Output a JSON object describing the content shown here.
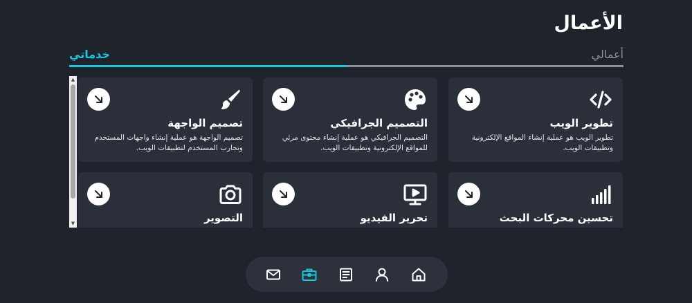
{
  "page": {
    "title": "الأعمال"
  },
  "tabs": [
    {
      "label": "أعمالي",
      "active": false
    },
    {
      "label": "خدماتي",
      "active": true
    }
  ],
  "colors": {
    "accent": "#19c7dc",
    "background": "#1e232c",
    "card": "#2a2f39"
  },
  "services": [
    {
      "title": "تطوير الويب",
      "description": "تطوير الويب هو عملية إنشاء المواقع الإلكترونية وتطبيقات الويب.",
      "icon": "code-icon"
    },
    {
      "title": "التصميم الجرافيكي",
      "description": "التصميم الجرافيكي هو عملية إنشاء محتوى مرئي للمواقع الإلكترونية وتطبيقات الويب.",
      "icon": "palette-icon"
    },
    {
      "title": "تصميم الواجهة",
      "description": "تصميم الواجهة هو عملية إنشاء واجهات المستخدم وتجارب المستخدم لتطبيقات الويب.",
      "icon": "brush-icon"
    },
    {
      "title": "تحسين محركات البحث",
      "description": "",
      "icon": "signal-bars-icon"
    },
    {
      "title": "تحرير الفيديو",
      "description": "",
      "icon": "monitor-play-icon"
    },
    {
      "title": "التصوير",
      "description": "",
      "icon": "camera-icon"
    }
  ],
  "nav": [
    {
      "icon": "mail-icon",
      "active": false
    },
    {
      "icon": "briefcase-icon",
      "active": true
    },
    {
      "icon": "document-icon",
      "active": false
    },
    {
      "icon": "user-icon",
      "active": false
    },
    {
      "icon": "home-icon",
      "active": false
    }
  ]
}
